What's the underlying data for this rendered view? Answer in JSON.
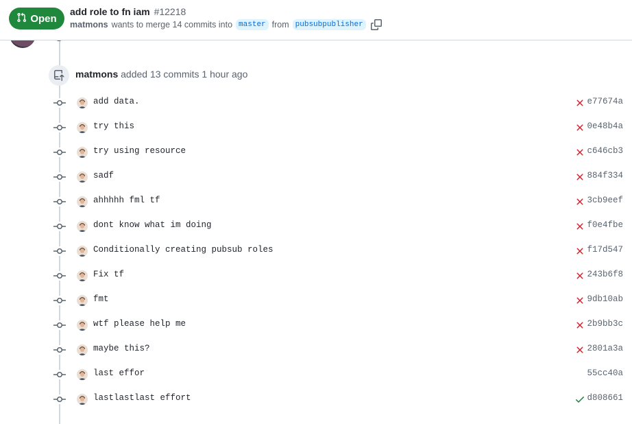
{
  "header": {
    "state_label": "Open",
    "state_icon": "git-pull-request-icon",
    "state_color": "#1f883d",
    "title": "add role to fn iam",
    "number": "#12218",
    "author": "matmons",
    "merge_text": "wants to merge 14 commits into",
    "base_branch": "master",
    "from_text": "from",
    "head_branch": "pubsubpublisher",
    "copy_icon": "copy-icon"
  },
  "event": {
    "icon": "repo-push-icon",
    "author": "matmons",
    "text": "added 13 commits 1 hour ago"
  },
  "colors": {
    "fail": "#cf222e",
    "success": "#1a7f37",
    "link": "#0969da"
  },
  "commits": [
    {
      "message": "add data.",
      "sha": "e77674a",
      "status": "failure",
      "status_icon": "x-icon"
    },
    {
      "message": "try this",
      "sha": "0e48b4a",
      "status": "failure",
      "status_icon": "x-icon"
    },
    {
      "message": "try using resource",
      "sha": "c646cb3",
      "status": "failure",
      "status_icon": "x-icon"
    },
    {
      "message": "sadf",
      "sha": "884f334",
      "status": "failure",
      "status_icon": "x-icon"
    },
    {
      "message": "ahhhhh fml tf",
      "sha": "3cb9eef",
      "status": "failure",
      "status_icon": "x-icon"
    },
    {
      "message": "dont know what im doing",
      "sha": "f0e4fbe",
      "status": "failure",
      "status_icon": "x-icon"
    },
    {
      "message": "Conditionally creating pubsub roles",
      "sha": "f17d547",
      "status": "failure",
      "status_icon": "x-icon"
    },
    {
      "message": "Fix tf",
      "sha": "243b6f8",
      "status": "failure",
      "status_icon": "x-icon"
    },
    {
      "message": "fmt",
      "sha": "9db10ab",
      "status": "failure",
      "status_icon": "x-icon"
    },
    {
      "message": "wtf please help me",
      "sha": "2b9bb3c",
      "status": "failure",
      "status_icon": "x-icon"
    },
    {
      "message": "maybe this?",
      "sha": "2801a3a",
      "status": "failure",
      "status_icon": "x-icon"
    },
    {
      "message": "last effor",
      "sha": "55cc40a",
      "status": "none",
      "status_icon": ""
    },
    {
      "message": "lastlastlast effort",
      "sha": "d808661",
      "status": "success",
      "status_icon": "check-icon"
    }
  ]
}
